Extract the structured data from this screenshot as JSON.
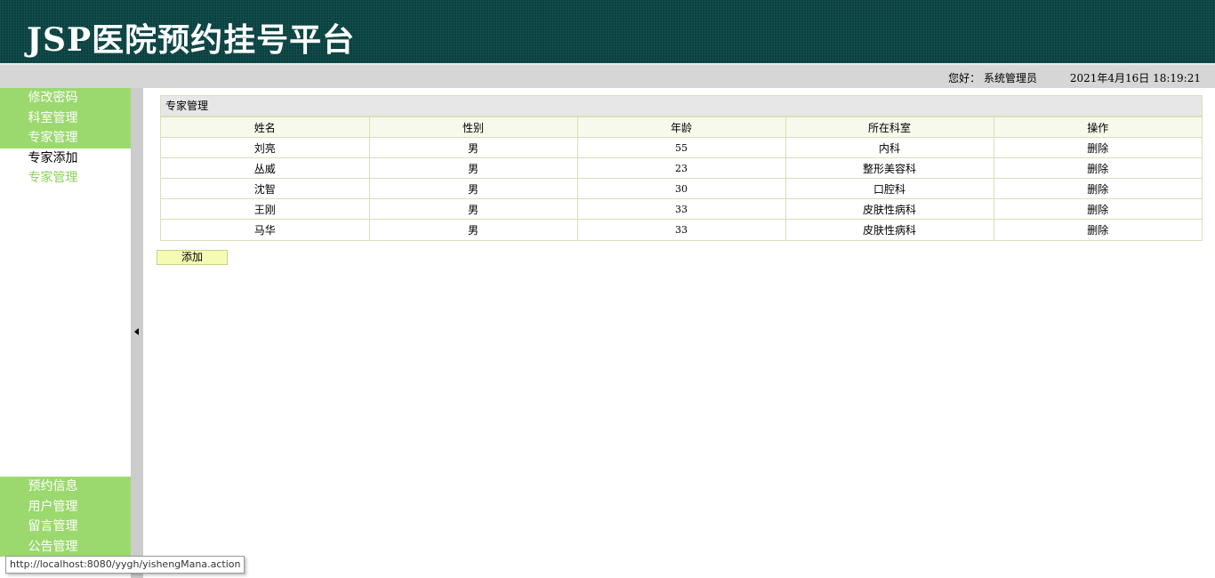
{
  "header": {
    "title": "JSP医院预约挂号平台"
  },
  "infobar": {
    "greeting": "您好：  系统管理员",
    "datetime": "2021年4月16日 18:19:21"
  },
  "sidebar": {
    "top_items": [
      {
        "label": "修改密码"
      },
      {
        "label": "科室管理"
      },
      {
        "label": "专家管理"
      }
    ],
    "sub_items": [
      {
        "label": "专家添加"
      },
      {
        "label": "专家管理"
      }
    ],
    "bottom_items": [
      {
        "label": "预约信息"
      },
      {
        "label": "用户管理"
      },
      {
        "label": "留言管理"
      },
      {
        "label": "公告管理"
      }
    ]
  },
  "panel": {
    "title": "专家管理",
    "columns": [
      "姓名",
      "性别",
      "年龄",
      "所在科室",
      "操作"
    ],
    "rows": [
      {
        "name": "刘亮",
        "gender": "男",
        "age": "55",
        "dept": "内科",
        "action": "删除"
      },
      {
        "name": "丛威",
        "gender": "男",
        "age": "23",
        "dept": "整形美容科",
        "action": "删除"
      },
      {
        "name": "沈智",
        "gender": "男",
        "age": "30",
        "dept": "口腔科",
        "action": "删除"
      },
      {
        "name": "王刚",
        "gender": "男",
        "age": "33",
        "dept": "皮肤性病科",
        "action": "删除"
      },
      {
        "name": "马华",
        "gender": "男",
        "age": "33",
        "dept": "皮肤性病科",
        "action": "删除"
      }
    ],
    "add_label": "添加"
  },
  "statusbar": {
    "url": "http://localhost:8080/yygh/yishengMana.action"
  },
  "colors": {
    "header_bg": "#06403f",
    "menu_green": "#9bd96e",
    "sub_green": "#8ccf5a",
    "add_button": "#f6fbb4"
  }
}
